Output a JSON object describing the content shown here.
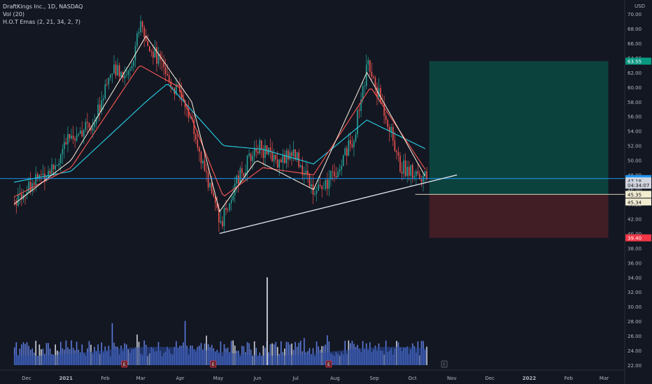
{
  "legend": {
    "symbol": "DraftKings Inc., 1D, NASDAQ",
    "volume": "Vol (20)",
    "indicator": "H.O.T Emas (2, 21, 34, 2, 7)"
  },
  "currency": "USD",
  "chart_data": {
    "type": "candlestick",
    "price_axis_labels": [
      "70.00",
      "68.00",
      "66.00",
      "64.00",
      "62.00",
      "60.00",
      "58.00",
      "56.00",
      "54.00",
      "52.00",
      "50.00",
      "48.00",
      "46.00",
      "44.00",
      "42.00",
      "40.00",
      "38.00",
      "36.00",
      "34.00",
      "32.00",
      "30.00",
      "28.00",
      "26.00",
      "24.00",
      "22.00"
    ],
    "ylim": [
      21.5,
      71.5
    ],
    "time_axis_labels": [
      "Dec",
      "2021",
      "Feb",
      "Mar",
      "Apr",
      "May",
      "Jun",
      "Jul",
      "Aug",
      "Sep",
      "Oct",
      "Nov",
      "Dec",
      "2022",
      "Feb",
      "Mar"
    ],
    "price_series": [
      {
        "date": "2020-12-01",
        "close": 44.5
      },
      {
        "date": "2020-12-15",
        "close": 47.0
      },
      {
        "date": "2021-01-01",
        "close": 49.0
      },
      {
        "date": "2021-01-15",
        "close": 53.5
      },
      {
        "date": "2021-02-01",
        "close": 55.0
      },
      {
        "date": "2021-02-15",
        "close": 62.0
      },
      {
        "date": "2021-03-01",
        "close": 62.0
      },
      {
        "date": "2021-03-10",
        "close": 68.5
      },
      {
        "date": "2021-03-20",
        "close": 65.0
      },
      {
        "date": "2021-04-01",
        "close": 61.0
      },
      {
        "date": "2021-04-15",
        "close": 58.0
      },
      {
        "date": "2021-05-01",
        "close": 48.0
      },
      {
        "date": "2021-05-12",
        "close": 41.0
      },
      {
        "date": "2021-05-25",
        "close": 47.0
      },
      {
        "date": "2021-06-10",
        "close": 52.0
      },
      {
        "date": "2021-06-25",
        "close": 50.0
      },
      {
        "date": "2021-07-10",
        "close": 51.0
      },
      {
        "date": "2021-07-25",
        "close": 45.0
      },
      {
        "date": "2021-08-10",
        "close": 48.0
      },
      {
        "date": "2021-08-25",
        "close": 53.0
      },
      {
        "date": "2021-09-05",
        "close": 63.0
      },
      {
        "date": "2021-09-20",
        "close": 56.0
      },
      {
        "date": "2021-10-01",
        "close": 49.0
      },
      {
        "date": "2021-10-15",
        "close": 48.5
      },
      {
        "date": "2021-10-22",
        "close": 47.18
      }
    ],
    "ema_fast": [
      {
        "date": "2020-12-01",
        "value": 44.0
      },
      {
        "date": "2021-01-15",
        "value": 50.0
      },
      {
        "date": "2021-03-05",
        "value": 64.0
      },
      {
        "date": "2021-03-15",
        "value": 67.0
      },
      {
        "date": "2021-04-20",
        "value": 58.0
      },
      {
        "date": "2021-05-12",
        "value": 43.0
      },
      {
        "date": "2021-06-10",
        "value": 50.0
      },
      {
        "date": "2021-07-25",
        "value": 46.0
      },
      {
        "date": "2021-09-05",
        "value": 62.0
      },
      {
        "date": "2021-10-22",
        "value": 47.5
      }
    ],
    "ema_mid": [
      {
        "date": "2020-12-01",
        "value": 45.0
      },
      {
        "date": "2021-01-15",
        "value": 49.0
      },
      {
        "date": "2021-03-10",
        "value": 63.0
      },
      {
        "date": "2021-04-10",
        "value": 60.0
      },
      {
        "date": "2021-05-15",
        "value": 45.0
      },
      {
        "date": "2021-06-15",
        "value": 49.0
      },
      {
        "date": "2021-07-25",
        "value": 48.0
      },
      {
        "date": "2021-09-08",
        "value": 60.0
      },
      {
        "date": "2021-10-22",
        "value": 48.5
      }
    ],
    "ema_slow": [
      {
        "date": "2020-12-01",
        "value": 47.0
      },
      {
        "date": "2021-01-15",
        "value": 48.5
      },
      {
        "date": "2021-03-15",
        "value": 58.0
      },
      {
        "date": "2021-04-01",
        "value": 60.5
      },
      {
        "date": "2021-05-15",
        "value": 52.0
      },
      {
        "date": "2021-06-15",
        "value": 51.5
      },
      {
        "date": "2021-07-25",
        "value": 49.5
      },
      {
        "date": "2021-09-05",
        "value": 55.5
      },
      {
        "date": "2021-10-22",
        "value": 51.5
      }
    ],
    "trendline": {
      "start": {
        "date": "2021-05-12",
        "value": 40.0
      },
      "end": {
        "date": "2021-11-15",
        "value": 48.0
      }
    },
    "horizontal_line": {
      "value": 47.5,
      "color": "#2196f3"
    },
    "position": {
      "entry": 45.35,
      "target": 63.55,
      "stop": 39.4,
      "start_date": "2021-10-22",
      "end_date": "2022-03-01"
    },
    "price_labels": [
      {
        "value": "63.55",
        "bg": "#089981",
        "fg": "#ffffff",
        "price": 63.55
      },
      {
        "value": "47.50",
        "bg": "#2196f3",
        "fg": "#ffffff",
        "price": 47.5
      },
      {
        "value": "47.18",
        "bg": "#d1d4dc",
        "fg": "#131722",
        "price": 47.18
      },
      {
        "value": "04:34:07",
        "bg": "#d1d4dc",
        "fg": "#131722",
        "price": 46.6
      },
      {
        "value": "45.35",
        "bg": "#f2ecd0",
        "fg": "#131722",
        "price": 45.35
      },
      {
        "value": "45.34",
        "bg": "#f2ecd0",
        "fg": "#131722",
        "price": 44.3
      },
      {
        "value": "39.40",
        "bg": "#f23645",
        "fg": "#ffffff",
        "price": 39.4
      }
    ],
    "volume_avg": 24.0,
    "volume_spike": 34.0,
    "earnings_markers": [
      "2021-02-26",
      "2021-05-07",
      "2021-08-06"
    ],
    "earnings_marker_text": "E",
    "future_marker_date": "2021-11-05",
    "colors": {
      "up": "#26a69a",
      "down": "#ef5350",
      "ema_fast": "#fff3e0",
      "ema_mid": "#ef5350",
      "ema_slow": "#26c6da",
      "volume": "#5b7ad9",
      "volume_area": "#2b4a9e",
      "target_zone": "#0c4a43",
      "stop_zone": "#4a1f26"
    }
  }
}
